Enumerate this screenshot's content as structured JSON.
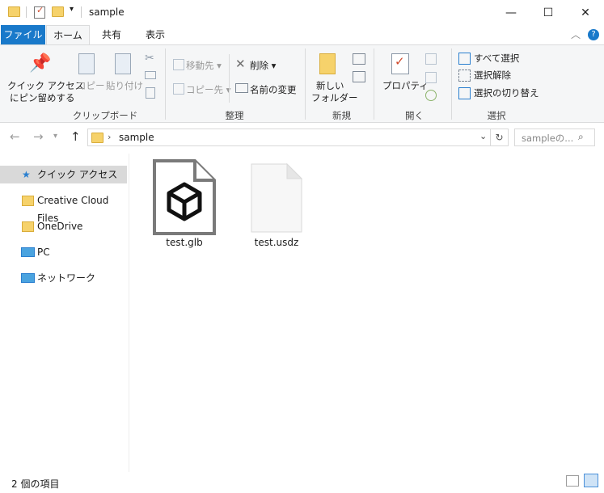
{
  "window": {
    "title": "sample",
    "minimize": "—",
    "maximize": "☐",
    "close": "✕"
  },
  "tabs": {
    "file": "ファイル",
    "home": "ホーム",
    "share": "共有",
    "view": "表示"
  },
  "ribbon": {
    "clipboard": {
      "pin_label_1": "クイック アクセス",
      "pin_label_2": "にピン留めする",
      "copy": "コピー",
      "paste": "貼り付け",
      "group": "クリップボード"
    },
    "organize": {
      "move_to": "移動先",
      "copy_to": "コピー先",
      "delete": "削除",
      "rename": "名前の変更",
      "group": "整理"
    },
    "new": {
      "new_folder_1": "新しい",
      "new_folder_2": "フォルダー",
      "group": "新規"
    },
    "open": {
      "properties": "プロパティ",
      "group": "開く"
    },
    "select": {
      "select_all": "すべて選択",
      "select_none": "選択解除",
      "invert": "選択の切り替え",
      "group": "選択"
    }
  },
  "address": {
    "path": "sample",
    "search_placeholder": "sampleの..."
  },
  "nav": {
    "items": [
      {
        "label": "クイック アクセス"
      },
      {
        "label": "Creative Cloud Files"
      },
      {
        "label": "OneDrive"
      },
      {
        "label": "PC"
      },
      {
        "label": "ネットワーク"
      }
    ]
  },
  "files": [
    {
      "name": "test.glb"
    },
    {
      "name": "test.usdz"
    }
  ],
  "status": {
    "item_count": "2 個の項目"
  },
  "colors": {
    "accent": "#1979ca",
    "folder": "#f6d26b",
    "selected_nav": "#d9d9d9"
  }
}
